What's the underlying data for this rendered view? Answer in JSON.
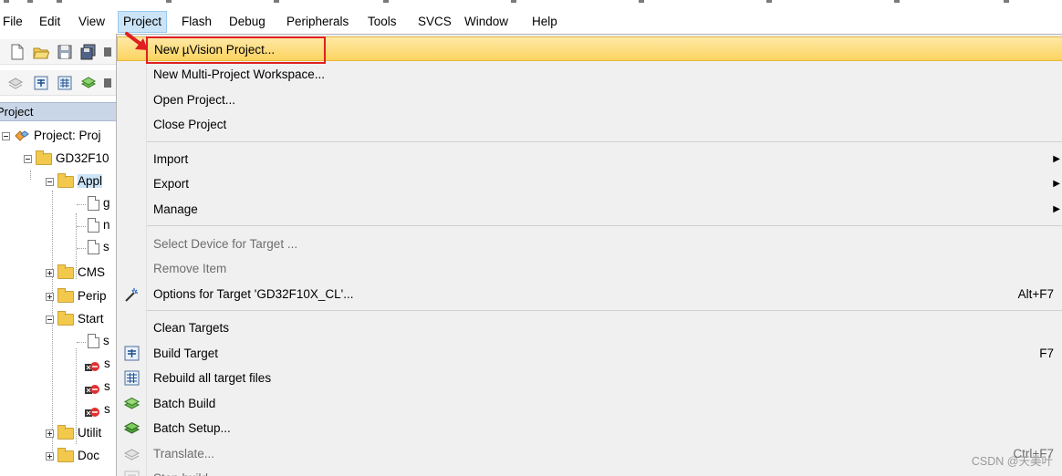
{
  "menubar": {
    "items": [
      "File",
      "Edit",
      "View",
      "Project",
      "Flash",
      "Debug",
      "Peripherals",
      "Tools",
      "SVCS",
      "Window",
      "Help"
    ],
    "active": "Project"
  },
  "left_panel": {
    "header": "Project",
    "tree": [
      {
        "label": "Project: Proj",
        "level": 0
      },
      {
        "label": "GD32F10",
        "level": 1
      },
      {
        "label": "Appl",
        "level": 2
      },
      {
        "label": "g",
        "level": 3
      },
      {
        "label": "n",
        "level": 3
      },
      {
        "label": "s",
        "level": 3
      },
      {
        "label": "CMS",
        "level": 2
      },
      {
        "label": "Perip",
        "level": 2
      },
      {
        "label": "Start",
        "level": 2
      },
      {
        "label": "s",
        "level": 3
      },
      {
        "label": "s",
        "level": 3
      },
      {
        "label": "s",
        "level": 3
      },
      {
        "label": "s",
        "level": 3
      },
      {
        "label": "Utilit",
        "level": 2
      },
      {
        "label": "Doc",
        "level": 2
      }
    ]
  },
  "project_menu": {
    "items": [
      {
        "label": "New µVision Project...",
        "highlighted": true
      },
      {
        "label": "New Multi-Project Workspace..."
      },
      {
        "label": "Open Project..."
      },
      {
        "label": "Close Project"
      },
      {
        "label": "Import",
        "submenu": true
      },
      {
        "label": "Export",
        "submenu": true
      },
      {
        "label": "Manage",
        "submenu": true
      },
      {
        "label": "Select Device for Target ...",
        "disabled": true
      },
      {
        "label": "Remove Item",
        "disabled": true
      },
      {
        "label": "Options for Target 'GD32F10X_CL'...",
        "shortcut": "Alt+F7",
        "icon": "options-wand-icon"
      },
      {
        "label": "Clean Targets"
      },
      {
        "label": "Build Target",
        "shortcut": "F7",
        "icon": "build-icon"
      },
      {
        "label": "Rebuild all target files",
        "icon": "rebuild-icon"
      },
      {
        "label": "Batch Build",
        "icon": "batch-build-icon"
      },
      {
        "label": "Batch Setup...",
        "icon": "batch-setup-icon"
      },
      {
        "label": "Translate...",
        "shortcut": "Ctrl+F7",
        "disabled": true,
        "icon": "translate-icon"
      },
      {
        "label": "Stop build",
        "disabled": true,
        "icon": "stop-build-icon"
      }
    ]
  },
  "annotation_color": "#e02020",
  "watermark": "CSDN @天美叶"
}
